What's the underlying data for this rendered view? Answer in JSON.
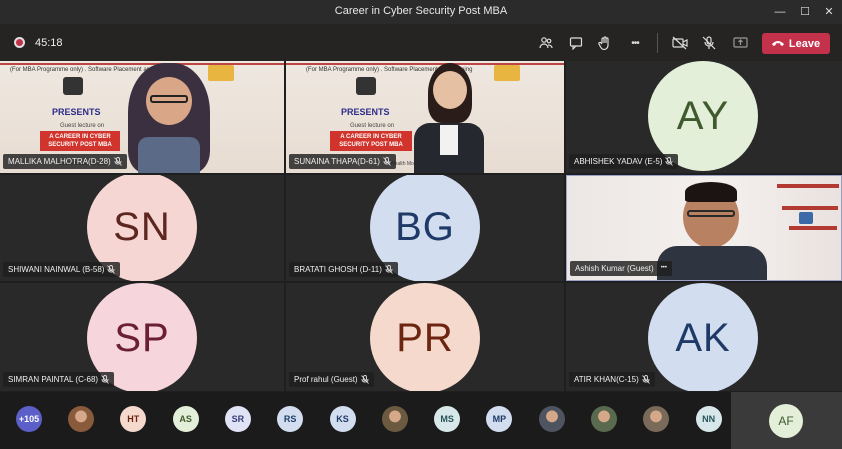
{
  "window": {
    "title": "Career in Cyber Security Post MBA",
    "minimize": "—",
    "maximize": "☐",
    "close": "✕"
  },
  "toolbar": {
    "timer": "45:18",
    "leave_label": "Leave",
    "more": "•••",
    "leave_color": "#c4314b"
  },
  "slides": {
    "header": "(For MBA Programme only) . Software Placement and Training",
    "presents": "PRESENTS",
    "guest": "Guest lecture on",
    "career": "A CAREER IN CYBER SECURITY POST MBA",
    "footer": "Wealth Mode Company"
  },
  "tiles": [
    {
      "name": "MALLIKA MALHOTRA(D-28)"
    },
    {
      "name": "SUNAINA THAPA(D-61)"
    },
    {
      "name": "ABHISHEK YADAV (E-5)",
      "initials": "AY",
      "bg": "#e3efd9",
      "fg": "#3f5a2e"
    },
    {
      "name": "SHIWANI NAINWAL (B-58)",
      "initials": "SN",
      "bg": "#f6d6d2",
      "fg": "#5e2620"
    },
    {
      "name": "BRATATI GHOSH (D-11)",
      "initials": "BG",
      "bg": "#d2def0",
      "fg": "#1f3a66"
    },
    {
      "name": "Ashish Kumar (Guest)",
      "more": "•••"
    },
    {
      "name": "SIMRAN PAINTAL (C-68)",
      "initials": "SP",
      "bg": "#f7d5dc",
      "fg": "#6a1f34"
    },
    {
      "name": "Prof rahul (Guest)",
      "initials": "PR",
      "bg": "#f6d9cd",
      "fg": "#6b2510"
    },
    {
      "name": "ATIR KHAN(C-15)",
      "initials": "AK",
      "bg": "#d2def0",
      "fg": "#1f3a66"
    }
  ],
  "roster": {
    "overflow": "+105",
    "participants": [
      {
        "label": "",
        "type": "photo"
      },
      {
        "label": "HT",
        "bg": "#f6d9cd",
        "fg": "#6b2510"
      },
      {
        "label": "AS",
        "bg": "#e3efd9",
        "fg": "#3f5a2e"
      },
      {
        "label": "SR",
        "bg": "#e0e2f5",
        "fg": "#373f7a"
      },
      {
        "label": "RS",
        "bg": "#d2def0",
        "fg": "#1f3a66"
      },
      {
        "label": "KS",
        "bg": "#d2def0",
        "fg": "#1f3a66"
      },
      {
        "label": "",
        "type": "photo"
      },
      {
        "label": "MS",
        "bg": "#d8e8ea",
        "fg": "#26535a"
      },
      {
        "label": "MP",
        "bg": "#d2def0",
        "fg": "#1f3a66"
      },
      {
        "label": "",
        "type": "photo"
      },
      {
        "label": "",
        "type": "photo"
      },
      {
        "label": "",
        "type": "photo"
      },
      {
        "label": "NN",
        "bg": "#d8e8ea",
        "fg": "#26535a"
      }
    ],
    "self": "AF"
  }
}
